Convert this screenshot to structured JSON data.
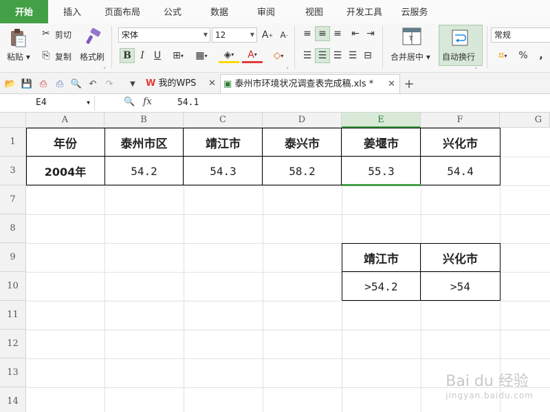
{
  "ribbon_tabs": [
    "开始",
    "插入",
    "页面布局",
    "公式",
    "数据",
    "审阅",
    "视图",
    "开发工具",
    "云服务"
  ],
  "clipboard": {
    "paste": "粘贴",
    "cut": "剪切",
    "copy": "复制",
    "format_painter": "格式刷"
  },
  "font": {
    "name": "宋体",
    "size": "12"
  },
  "alignment": {
    "merge_center": "合并居中",
    "wrap_text": "自动换行"
  },
  "number_format": "常规",
  "doc_tabs": {
    "home": "我的WPS",
    "file": "泰州市环境状况调查表完成稿.xls *"
  },
  "formula_bar": {
    "cell_ref": "E4",
    "fx": "fx",
    "value": "54.1"
  },
  "columns": [
    "A",
    "B",
    "C",
    "D",
    "E",
    "F",
    "G"
  ],
  "selected_column": "E",
  "rows": [
    "1",
    "3",
    "7",
    "8",
    "9",
    "10",
    "11",
    "12",
    "13",
    "14"
  ],
  "table": {
    "header": [
      "年份",
      "泰州市区",
      "靖江市",
      "泰兴市",
      "姜堰市",
      "兴化市"
    ],
    "row": [
      "2004年",
      "54.2",
      "54.3",
      "58.2",
      "55.3",
      "54.4"
    ]
  },
  "criteria": {
    "header": [
      "靖江市",
      "兴化市"
    ],
    "row": [
      ">54.2",
      ">54"
    ]
  },
  "watermark": {
    "brand": "Bai du 经验",
    "url": "jingyan.baidu.com"
  }
}
